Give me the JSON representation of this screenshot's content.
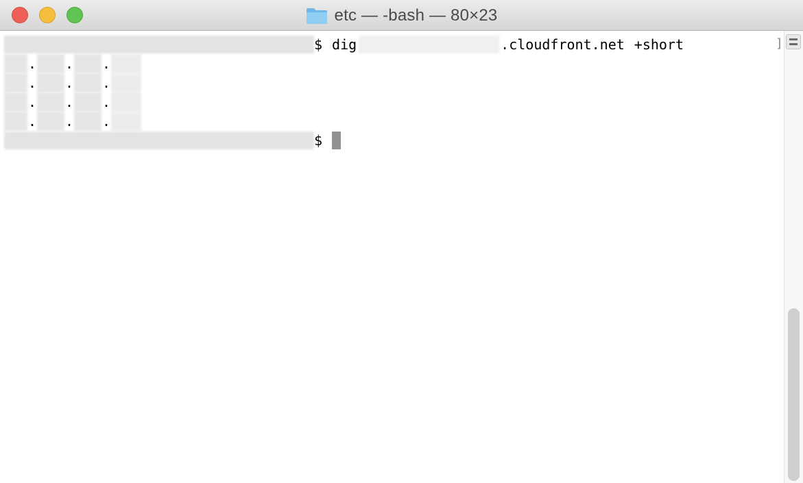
{
  "window": {
    "title": "etc — -bash — 80×23",
    "folder_icon": "folder-icon"
  },
  "traffic_lights": {
    "close_color": "#ee5f57",
    "minimize_color": "#f6be3b",
    "zoom_color": "#5fc454"
  },
  "terminal": {
    "prompt_symbol": "$",
    "command_verb": "dig",
    "command_domain_suffix": ".cloudfront.net",
    "command_flag": "+short",
    "ip_separator": ".",
    "result_count": 4,
    "cursor_color": "#929292",
    "right_bracket": "]"
  },
  "scrollbar": {
    "split_icon": "split-pane-icon"
  }
}
